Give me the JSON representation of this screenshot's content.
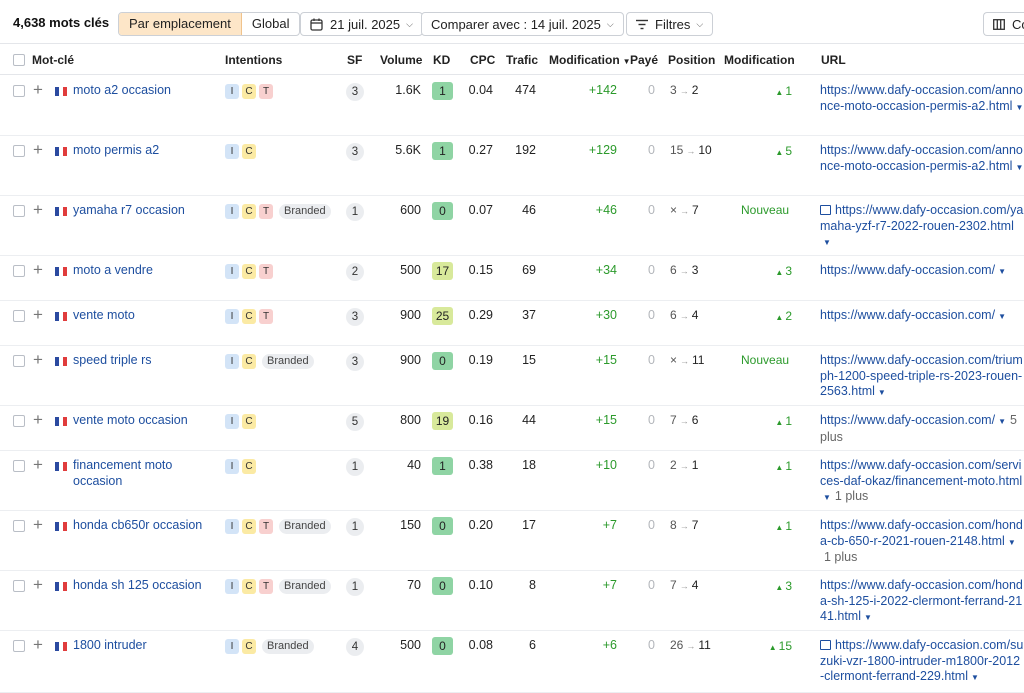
{
  "toolbar": {
    "count": "4,638 mots clés",
    "seg_active": "Par emplacement",
    "seg_other": "Global",
    "date": "21 juil. 2025",
    "compare": "Comparer avec : 14 juil. 2025",
    "filters": "Filtres",
    "columns": "Co"
  },
  "columns": {
    "keyword": "Mot-clé",
    "intents": "Intentions",
    "sf": "SF",
    "volume": "Volume",
    "kd": "KD",
    "cpc": "CPC",
    "traffic": "Trafic",
    "traffic_change": "Modification",
    "paid": "Payé",
    "position": "Position",
    "pos_change": "Modification",
    "url": "URL"
  },
  "colors": {
    "link": "#1d4e9f",
    "positive": "#2b9a2b",
    "kd_easy": "#8fd4a4",
    "kd_mid": "#d8e99b"
  },
  "rows": [
    {
      "keyword": "moto a2 occasion",
      "intents": [
        "I",
        "C",
        "T"
      ],
      "branded": "",
      "sf": "3",
      "volume": "1.6K",
      "kd": "1",
      "cpc": "0.04",
      "traffic": "474",
      "traffic_change": "+142",
      "paid": "0",
      "pos_from": "3",
      "pos_to": "2",
      "pos_change": "1",
      "url": "https://www.dafy-occasion.com/annonce-moto-occasion-permis-a2.html",
      "url_more": "",
      "url_img": false
    },
    {
      "keyword": "moto permis a2",
      "intents": [
        "I",
        "C"
      ],
      "branded": "",
      "sf": "3",
      "volume": "5.6K",
      "kd": "1",
      "cpc": "0.27",
      "traffic": "192",
      "traffic_change": "+129",
      "paid": "0",
      "pos_from": "15",
      "pos_to": "10",
      "pos_change": "5",
      "url": "https://www.dafy-occasion.com/annonce-moto-occasion-permis-a2.html",
      "url_more": "",
      "url_img": false
    },
    {
      "keyword": "yamaha r7 occasion",
      "intents": [
        "I",
        "C",
        "T"
      ],
      "branded": "Branded",
      "sf": "1",
      "volume": "600",
      "kd": "0",
      "cpc": "0.07",
      "traffic": "46",
      "traffic_change": "+46",
      "paid": "0",
      "pos_from": "×",
      "pos_to": "7",
      "pos_change": "Nouveau",
      "url": "https://www.dafy-occasion.com/yamaha-yzf-r7-2022-rouen-2302.html",
      "url_more": "",
      "url_img": true
    },
    {
      "keyword": "moto a vendre",
      "intents": [
        "I",
        "C",
        "T"
      ],
      "branded": "",
      "sf": "2",
      "volume": "500",
      "kd": "17",
      "cpc": "0.15",
      "traffic": "69",
      "traffic_change": "+34",
      "paid": "0",
      "pos_from": "6",
      "pos_to": "3",
      "pos_change": "3",
      "url": "https://www.dafy-occasion.com/",
      "url_more": "",
      "url_img": false
    },
    {
      "keyword": "vente moto",
      "intents": [
        "I",
        "C",
        "T"
      ],
      "branded": "",
      "sf": "3",
      "volume": "900",
      "kd": "25",
      "cpc": "0.29",
      "traffic": "37",
      "traffic_change": "+30",
      "paid": "0",
      "pos_from": "6",
      "pos_to": "4",
      "pos_change": "2",
      "url": "https://www.dafy-occasion.com/",
      "url_more": "",
      "url_img": false
    },
    {
      "keyword": "speed triple rs",
      "intents": [
        "I",
        "C"
      ],
      "branded": "Branded",
      "sf": "3",
      "volume": "900",
      "kd": "0",
      "cpc": "0.19",
      "traffic": "15",
      "traffic_change": "+15",
      "paid": "0",
      "pos_from": "×",
      "pos_to": "11",
      "pos_change": "Nouveau",
      "url": "https://www.dafy-occasion.com/triumph-1200-speed-triple-rs-2023-rouen-2563.html",
      "url_more": "",
      "url_img": false
    },
    {
      "keyword": "vente moto occasion",
      "intents": [
        "I",
        "C"
      ],
      "branded": "",
      "sf": "5",
      "volume": "800",
      "kd": "19",
      "cpc": "0.16",
      "traffic": "44",
      "traffic_change": "+15",
      "paid": "0",
      "pos_from": "7",
      "pos_to": "6",
      "pos_change": "1",
      "url": "https://www.dafy-occasion.com/",
      "url_more": "5 plus",
      "url_img": false
    },
    {
      "keyword": "financement moto occasion",
      "intents": [
        "I",
        "C"
      ],
      "branded": "",
      "sf": "1",
      "volume": "40",
      "kd": "1",
      "cpc": "0.38",
      "traffic": "18",
      "traffic_change": "+10",
      "paid": "0",
      "pos_from": "2",
      "pos_to": "1",
      "pos_change": "1",
      "url": "https://www.dafy-occasion.com/services-daf-okaz/financement-moto.html",
      "url_more": "1 plus",
      "url_img": false
    },
    {
      "keyword": "honda cb650r occasion",
      "intents": [
        "I",
        "C",
        "T"
      ],
      "branded": "Branded",
      "sf": "1",
      "volume": "150",
      "kd": "0",
      "cpc": "0.20",
      "traffic": "17",
      "traffic_change": "+7",
      "paid": "0",
      "pos_from": "8",
      "pos_to": "7",
      "pos_change": "1",
      "url": "https://www.dafy-occasion.com/honda-cb-650-r-2021-rouen-2148.html",
      "url_more": "1 plus",
      "url_img": false
    },
    {
      "keyword": "honda sh 125 occasion",
      "intents": [
        "I",
        "C",
        "T"
      ],
      "branded": "Branded",
      "sf": "1",
      "volume": "70",
      "kd": "0",
      "cpc": "0.10",
      "traffic": "8",
      "traffic_change": "+7",
      "paid": "0",
      "pos_from": "7",
      "pos_to": "4",
      "pos_change": "3",
      "url": "https://www.dafy-occasion.com/honda-sh-125-i-2022-clermont-ferrand-2141.html",
      "url_more": "",
      "url_img": false
    },
    {
      "keyword": "1800 intruder",
      "intents": [
        "I",
        "C"
      ],
      "branded": "Branded",
      "sf": "4",
      "volume": "500",
      "kd": "0",
      "cpc": "0.08",
      "traffic": "6",
      "traffic_change": "+6",
      "paid": "0",
      "pos_from": "26",
      "pos_to": "11",
      "pos_change": "15",
      "url": "https://www.dafy-occasion.com/suzuki-vzr-1800-intruder-m1800r-2012-clermont-ferrand-229.html",
      "url_more": "",
      "url_img": true
    }
  ]
}
